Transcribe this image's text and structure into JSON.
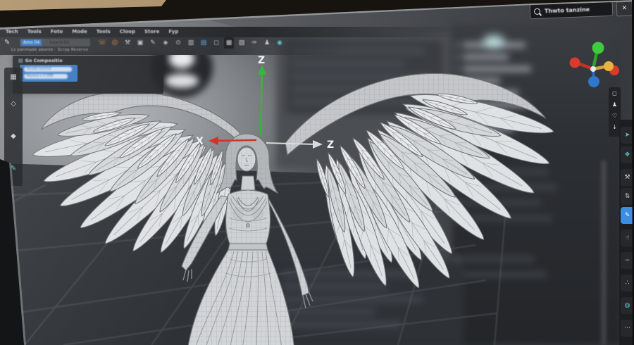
{
  "colors": {
    "selection_blue": "#3a78c3",
    "accent_teal": "#53c6cb",
    "accent_orange": "#d08440",
    "tool_active_blue": "#3d8de2",
    "axis_up_green": "#35b53a",
    "axis_left_red": "#cf3227",
    "axis_right_white": "#d9dadb",
    "gizmo_yellow": "#e8b440",
    "gizmo_blue": "#3077cf"
  },
  "window": {
    "close_label": "✕"
  },
  "search": {
    "value": "Thwto tanzine"
  },
  "menu_items": [
    "Tech",
    "Tools",
    "Foto",
    "Mode",
    "Tools",
    "Cloop",
    "Store",
    "Fyp"
  ],
  "name_bar": {
    "selected": "Amo 04",
    "rest": "Award-Bit",
    "breadcrumb": "Ls panmade abonte · Scrap Reserve"
  },
  "main_toolbar": [
    {
      "name": "grab-tool",
      "glyph": "☏"
    },
    {
      "name": "record-tool",
      "glyph": "◎"
    },
    {
      "name": "clamp-tool",
      "glyph": "⚒"
    },
    {
      "name": "frame-tool",
      "glyph": "▣"
    },
    {
      "name": "pen-tool",
      "glyph": "✎"
    },
    {
      "name": "tag-tool",
      "glyph": "◈"
    },
    {
      "name": "zoom-tool",
      "glyph": "⊙"
    },
    {
      "name": "copy-tool",
      "glyph": "▥"
    },
    {
      "name": "folder-tool",
      "glyph": "▤"
    },
    {
      "name": "monitor-tool",
      "glyph": "◻"
    },
    {
      "name": "trash-tool",
      "glyph": "▦"
    },
    {
      "name": "image-tool",
      "glyph": "▧"
    },
    {
      "name": "brush-tool",
      "glyph": "✑"
    },
    {
      "name": "figure-tool",
      "glyph": "♟"
    },
    {
      "name": "washer-tool",
      "glyph": "◉"
    }
  ],
  "left_panel": {
    "header": "Go Compositio",
    "options": [
      "Anode kontrol",
      "Rezere o II 09B"
    ]
  },
  "left_toolbar": [
    {
      "name": "grid-tool",
      "glyph": "▦"
    },
    {
      "name": "diamond-tool",
      "glyph": "◇"
    },
    {
      "name": "gem-tool",
      "glyph": "◆"
    },
    {
      "name": "pen-tool",
      "glyph": "✎"
    }
  ],
  "viewport": {
    "axes": {
      "up": "Z",
      "left": "X",
      "right": "Z"
    }
  },
  "right_strip": [
    {
      "name": "square-icon",
      "glyph": "◻"
    },
    {
      "name": "bust-icon",
      "glyph": "♟"
    },
    {
      "name": "heart-icon",
      "glyph": "♡"
    },
    {
      "name": "download-icon",
      "glyph": "↓"
    }
  ],
  "right_toolbar": [
    {
      "name": "cursor-tool",
      "glyph": "➤"
    },
    {
      "name": "nav-tool",
      "glyph": "❖"
    },
    {
      "name": "measure-tool",
      "glyph": "⚒"
    },
    {
      "name": "swap-tool",
      "glyph": "⇅"
    },
    {
      "name": "draw-tool",
      "glyph": "✎"
    },
    {
      "name": "point-tool",
      "glyph": "☝"
    },
    {
      "name": "link-tool",
      "glyph": "∽"
    },
    {
      "name": "scatter-tool",
      "glyph": "∴"
    },
    {
      "name": "sphere-tool",
      "glyph": "◍"
    },
    {
      "name": "more-tools",
      "glyph": "⋯"
    }
  ]
}
